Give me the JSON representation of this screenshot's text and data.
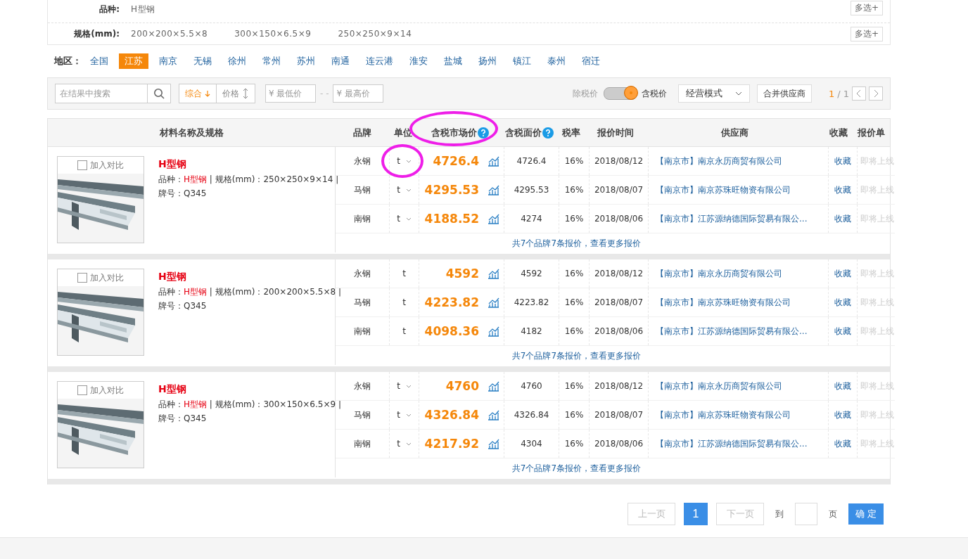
{
  "filters": [
    {
      "label": "品种:",
      "options": [
        {
          "text": "H型钢"
        }
      ],
      "more": "多选+"
    },
    {
      "label": "规格(mm):",
      "options": [
        {
          "text": "200×200×5.5×8"
        },
        {
          "text": "300×150×6.5×9"
        },
        {
          "text": "250×250×9×14"
        }
      ],
      "more": "多选+"
    }
  ],
  "region": {
    "label": "地区：",
    "items": [
      {
        "text": "全国",
        "selected": false
      },
      {
        "text": "江苏",
        "selected": true
      },
      {
        "text": "南京",
        "selected": false
      },
      {
        "text": "无锡",
        "selected": false
      },
      {
        "text": "徐州",
        "selected": false
      },
      {
        "text": "常州",
        "selected": false
      },
      {
        "text": "苏州",
        "selected": false
      },
      {
        "text": "南通",
        "selected": false
      },
      {
        "text": "连云港",
        "selected": false
      },
      {
        "text": "淮安",
        "selected": false
      },
      {
        "text": "盐城",
        "selected": false
      },
      {
        "text": "扬州",
        "selected": false
      },
      {
        "text": "镇江",
        "selected": false
      },
      {
        "text": "泰州",
        "selected": false
      },
      {
        "text": "宿迁",
        "selected": false
      }
    ]
  },
  "toolbar": {
    "search_placeholder": "在结果中搜索",
    "sorts": [
      {
        "text": "综合",
        "selected": true
      },
      {
        "text": "价格",
        "selected": false
      }
    ],
    "min_price_placeholder": "¥ 最低价",
    "range_sep": "- -",
    "max_price_placeholder": "¥ 最高价",
    "tax_off": "除税价",
    "tax_on": "含税价",
    "tax_included": true,
    "mode": "经营模式",
    "merge": "合并供应商",
    "page_current": "1",
    "page_sep": "/",
    "page_total": "1"
  },
  "table": {
    "columns": [
      {
        "text": "材料名称及规格",
        "help": false,
        "circled": false
      },
      {
        "text": "品牌",
        "help": false,
        "circled": false
      },
      {
        "text": "单位",
        "help": false,
        "circled": false
      },
      {
        "text": "含税市场价",
        "help": true,
        "circled": true
      },
      {
        "text": "含税面价",
        "help": true,
        "circled": false
      },
      {
        "text": "税率",
        "help": false,
        "circled": false
      },
      {
        "text": "报价时间",
        "help": false,
        "circled": false
      },
      {
        "text": "供应商",
        "help": false,
        "circled": false
      },
      {
        "text": "收藏",
        "help": false,
        "circled": false
      },
      {
        "text": "报价单",
        "help": false,
        "circled": false
      }
    ],
    "products": [
      {
        "compare": "加入对比",
        "checked": false,
        "name": "H型钢",
        "spec_label": "品种：",
        "variety": "H型钢",
        "spec": " | 规格(mm)：250×250×9×14 |",
        "grade": "牌号：Q345",
        "unit_dropdown": true,
        "rows": [
          {
            "brand": "永钢",
            "unit": "t",
            "circled": true,
            "price": "4726.4",
            "face": "4726.4",
            "tax": "16%",
            "date": "2018/08/12",
            "city": "【南京市】",
            "supplier": "南京永历商贸有限公司",
            "collect": "收藏",
            "quote": "即将上线"
          },
          {
            "brand": "马钢",
            "unit": "t",
            "circled": false,
            "price": "4295.53",
            "face": "4295.53",
            "tax": "16%",
            "date": "2018/08/07",
            "city": "【南京市】",
            "supplier": "南京苏珠旺物资有限公司",
            "collect": "收藏",
            "quote": "即将上线"
          },
          {
            "brand": "南钢",
            "unit": "t",
            "circled": false,
            "price": "4188.52",
            "face": "4274",
            "tax": "16%",
            "date": "2018/08/06",
            "city": "【南京市】",
            "supplier": "江苏源纳德国际贸易有限公...",
            "collect": "收藏",
            "quote": "即将上线"
          }
        ],
        "more": "共7个品牌7条报价，查看更多报价"
      },
      {
        "compare": "加入对比",
        "checked": false,
        "name": "H型钢",
        "spec_label": "品种：",
        "variety": "H型钢",
        "spec": " | 规格(mm)：200×200×5.5×8 |",
        "grade": "牌号：Q345",
        "unit_dropdown": false,
        "rows": [
          {
            "brand": "永钢",
            "unit": "t",
            "circled": false,
            "price": "4592",
            "face": "4592",
            "tax": "16%",
            "date": "2018/08/12",
            "city": "【南京市】",
            "supplier": "南京永历商贸有限公司",
            "collect": "收藏",
            "quote": "即将上线"
          },
          {
            "brand": "马钢",
            "unit": "t",
            "circled": false,
            "price": "4223.82",
            "face": "4223.82",
            "tax": "16%",
            "date": "2018/08/07",
            "city": "【南京市】",
            "supplier": "南京苏珠旺物资有限公司",
            "collect": "收藏",
            "quote": "即将上线"
          },
          {
            "brand": "南钢",
            "unit": "t",
            "circled": false,
            "price": "4098.36",
            "face": "4182",
            "tax": "16%",
            "date": "2018/08/06",
            "city": "【南京市】",
            "supplier": "江苏源纳德国际贸易有限公...",
            "collect": "收藏",
            "quote": "即将上线"
          }
        ],
        "more": "共7个品牌7条报价，查看更多报价"
      },
      {
        "compare": "加入对比",
        "checked": false,
        "name": "H型钢",
        "spec_label": "品种：",
        "variety": "H型钢",
        "spec": " | 规格(mm)：300×150×6.5×9 |",
        "grade": "牌号：Q345",
        "unit_dropdown": true,
        "rows": [
          {
            "brand": "永钢",
            "unit": "t",
            "circled": false,
            "price": "4760",
            "face": "4760",
            "tax": "16%",
            "date": "2018/08/12",
            "city": "【南京市】",
            "supplier": "南京永历商贸有限公司",
            "collect": "收藏",
            "quote": "即将上线"
          },
          {
            "brand": "马钢",
            "unit": "t",
            "circled": false,
            "price": "4326.84",
            "face": "4326.84",
            "tax": "16%",
            "date": "2018/08/07",
            "city": "【南京市】",
            "supplier": "南京苏珠旺物资有限公司",
            "collect": "收藏",
            "quote": "即将上线"
          },
          {
            "brand": "南钢",
            "unit": "t",
            "circled": false,
            "price": "4217.92",
            "face": "4304",
            "tax": "16%",
            "date": "2018/08/06",
            "city": "【南京市】",
            "supplier": "江苏源纳德国际贸易有限公...",
            "collect": "收藏",
            "quote": "即将上线"
          }
        ],
        "more": "共7个品牌7条报价，查看更多报价"
      }
    ]
  },
  "pagination": {
    "prev": "上一页",
    "pages": [
      {
        "text": "1",
        "selected": true
      }
    ],
    "next": "下一页",
    "goto": "到",
    "page_unit": "页",
    "confirm": "确 定"
  }
}
